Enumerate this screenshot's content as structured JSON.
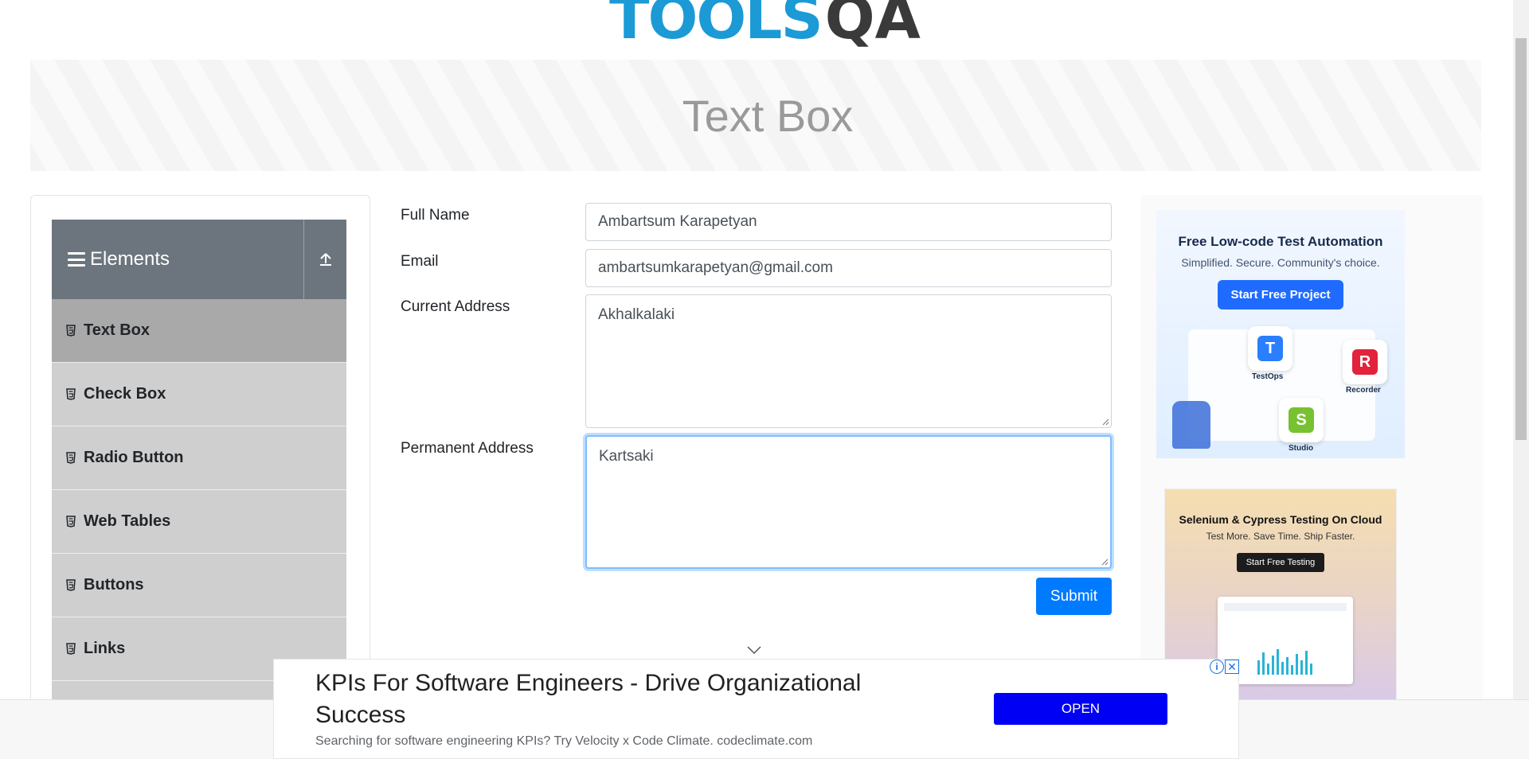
{
  "logo": {
    "part1": "TOOLS",
    "part2": "QA"
  },
  "banner": {
    "title": "Text Box"
  },
  "sidebar": {
    "group_title": "Elements",
    "items": [
      {
        "label": "Text Box"
      },
      {
        "label": "Check Box"
      },
      {
        "label": "Radio Button"
      },
      {
        "label": "Web Tables"
      },
      {
        "label": "Buttons"
      },
      {
        "label": "Links"
      }
    ]
  },
  "form": {
    "full_name": {
      "label": "Full Name",
      "value": "Ambartsum Karapetyan"
    },
    "email": {
      "label": "Email",
      "value": "ambartsumkarapetyan@gmail.com"
    },
    "current_address": {
      "label": "Current Address",
      "value": "Akhalkalaki"
    },
    "permanent_address": {
      "label": "Permanent Address",
      "value": "Kartsaki"
    },
    "submit_label": "Submit"
  },
  "ads": {
    "ad1": {
      "title": "Free Low-code Test Automation",
      "subtitle": "Simplified. Secure. Community's choice.",
      "button": "Start Free Project",
      "apps": [
        "TestOps",
        "Recorder",
        "Studio"
      ]
    },
    "ad2": {
      "title": "Selenium & Cypress Testing On Cloud",
      "subtitle": "Test More. Save Time. Ship Faster.",
      "button": "Start Free Testing"
    },
    "bottom": {
      "title": "KPIs For Software Engineers - Drive Organizational Success",
      "description": "Searching for software engineering KPIs? Try Velocity x Code Climate. codeclimate.com",
      "button": "OPEN"
    }
  },
  "colors": {
    "primary": "#007bff",
    "sidebar_header": "#6c757d",
    "menu_active": "#a9a9a9",
    "menu_item": "#cfcfcf",
    "ad_open": "#0000f5"
  }
}
